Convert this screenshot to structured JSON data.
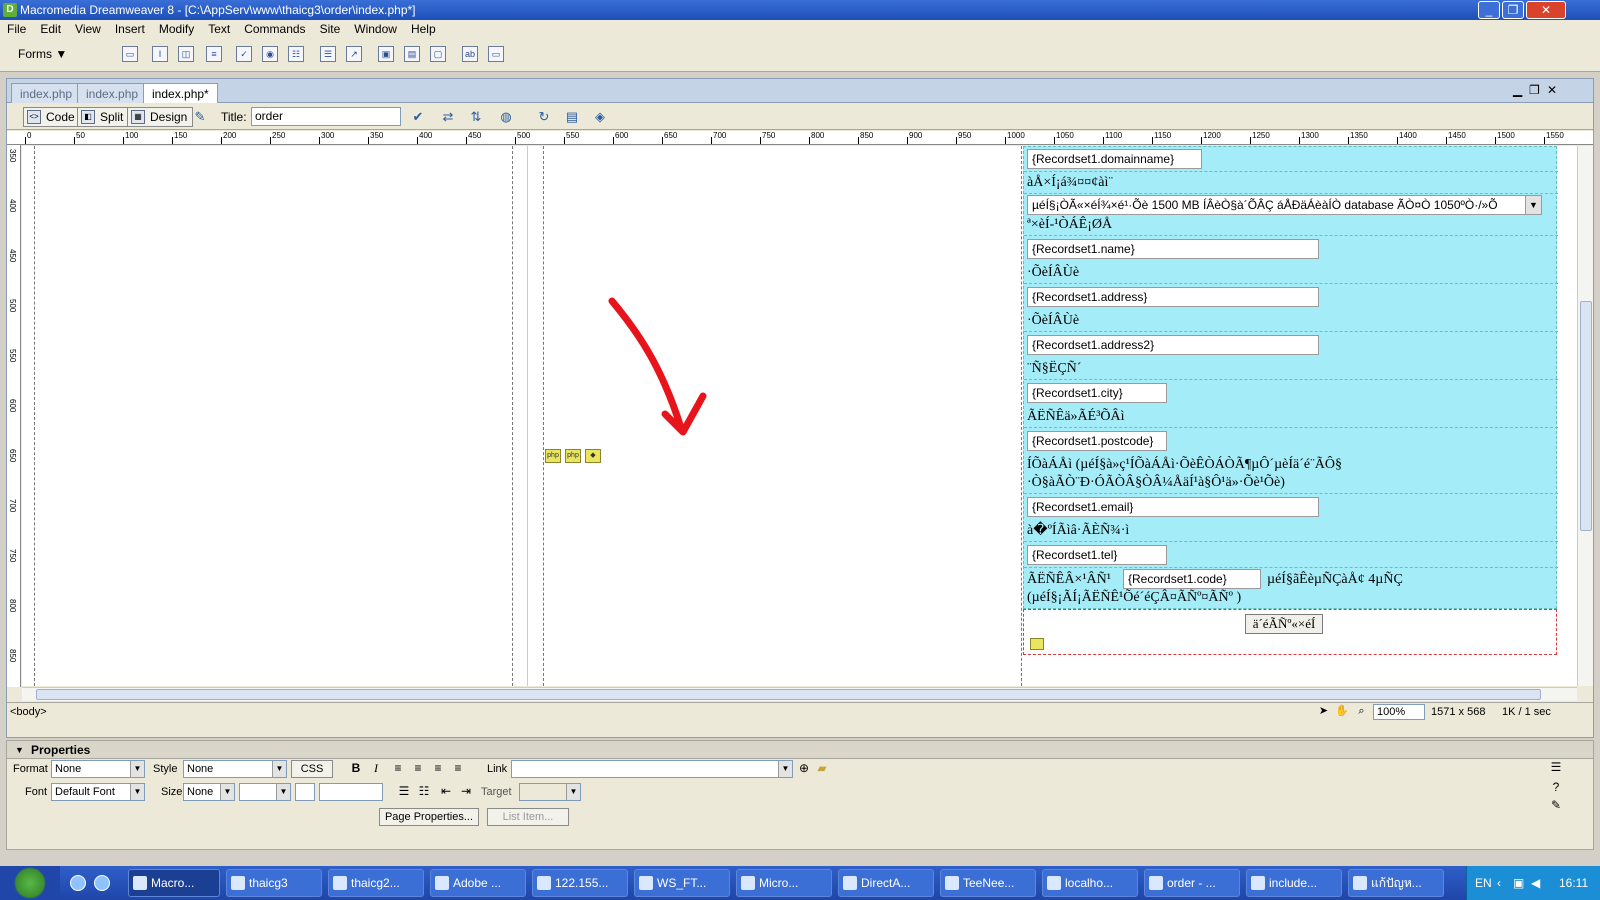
{
  "window": {
    "title": "Macromedia Dreamweaver 8 - [C:\\AppServ\\www\\thaicg3\\order\\index.php*]",
    "controls": [
      "_",
      "❐",
      "✕"
    ]
  },
  "menu": [
    "File",
    "Edit",
    "View",
    "Insert",
    "Modify",
    "Text",
    "Commands",
    "Site",
    "Window",
    "Help"
  ],
  "insert_toolbar": {
    "category": "Forms",
    "icons": [
      "form-icon",
      "text-field-icon",
      "hidden-field-icon",
      "textarea-icon",
      "checkbox-icon",
      "radio-button-icon",
      "radio-group-icon",
      "list-menu-icon",
      "jump-menu-icon",
      "image-field-icon",
      "file-field-icon",
      "button-icon",
      "label-icon",
      "fieldset-icon"
    ]
  },
  "doc_tabs": [
    {
      "label": "index.php",
      "active": false
    },
    {
      "label": "index.php",
      "active": false
    },
    {
      "label": "index.php*",
      "active": true
    }
  ],
  "doc_toolbar": {
    "code_label": "Code",
    "split_label": "Split",
    "design_label": "Design",
    "title_label": "Title:",
    "title_value": "order"
  },
  "ruler": {
    "h_labels": [
      "0",
      "50",
      "100",
      "150",
      "200",
      "250",
      "300",
      "350",
      "400",
      "450",
      "500",
      "550",
      "600",
      "650",
      "700",
      "750",
      "800",
      "850",
      "900",
      "950",
      "1000",
      "1050",
      "1100",
      "1150",
      "1200",
      "1250",
      "1300",
      "1350",
      "1400",
      "1450",
      "1500",
      "1550"
    ],
    "v_labels": [
      "350",
      "400",
      "450",
      "500",
      "550",
      "600",
      "650",
      "700",
      "750",
      "800",
      "850"
    ]
  },
  "form": {
    "rows": [
      {
        "type": "input",
        "text": "{Recordset1.domainname}"
      },
      {
        "type": "label",
        "text": "àÅ×Í¡á¾¤¤¢àì¨"
      },
      {
        "type": "select",
        "text": "µéÍ§¡ÒÃ«×éÍ¾×é¹·Õè 1500 MB ÍÂèÒ§à´ÕÂÇ áÅÐäÁèàÍÒ database ÃÒ¤Ò 1050ºÒ·/»Õ"
      },
      {
        "type": "label",
        "text": "ª×èÍ-¹ÒÁÊ¡ØÅ"
      },
      {
        "type": "input",
        "text": "{Recordset1.name}"
      },
      {
        "type": "label",
        "text": "·ÕèÍÂÙè"
      },
      {
        "type": "input",
        "text": "{Recordset1.address}"
      },
      {
        "type": "label",
        "text": "·ÕèÍÂÙè"
      },
      {
        "type": "input",
        "text": "{Recordset1.address2}"
      },
      {
        "type": "label",
        "text": "¨Ñ§ËÇÑ´"
      },
      {
        "type": "input",
        "text": "{Recordset1.city}"
      },
      {
        "type": "label",
        "text": "ÃËÑÊä»ÃÉ³ÕÂì"
      },
      {
        "type": "input",
        "text": "{Recordset1.postcode}"
      },
      {
        "type": "label",
        "text": "ÍÕàÁÅì (µéÍ§à»ç¹ÍÕàÁÅì·ÕèÊÒÁÒÃ¶µÔ´µèÍä´é¨ÃÔ§"
      },
      {
        "type": "label",
        "text": "·Ò§àÃÒ¨Ð·ÓÃÒÂ§ÒÂ¼ÅäÍ¹à§Ô¹ä»·Õè¹Õè)"
      },
      {
        "type": "input",
        "text": "{Recordset1.email}"
      },
      {
        "type": "label",
        "text": "à�ºÍÃìâ·ÃÈÑ¾·ì"
      },
      {
        "type": "input",
        "text": "{Recordset1.tel}"
      },
      {
        "type": "label",
        "text": "ÃËÑÊÂ×¹ÂÑ¹"
      },
      {
        "type": "input",
        "text": "{Recordset1.code}"
      },
      {
        "type": "label",
        "text": "µéÍ§ãÊèµÑÇàÅ¢ 4µÑÇ"
      },
      {
        "type": "label",
        "text": "(µéÍ§¡ÃÍ¡ÃËÑÊ¹Õé´éÇÂ¤ÃÑº¤ÃÑº )"
      }
    ],
    "submit_label": "ä´éÃÑº«×éÍ"
  },
  "status": {
    "tag": "<body>",
    "zoom": "100%",
    "window_size": "1571 x 568",
    "download": "1K / 1 sec"
  },
  "properties": {
    "header": "Properties",
    "format_label": "Format",
    "format_value": "None",
    "style_label": "Style",
    "style_value": "None",
    "css_label": "CSS",
    "link_label": "Link",
    "link_value": "",
    "font_label": "Font",
    "font_value": "Default Font",
    "size_label": "Size",
    "size_value": "None",
    "target_label": "Target",
    "page_properties_label": "Page Properties...",
    "list_item_label": "List Item..."
  },
  "taskbar": {
    "tasks": [
      "Macro...",
      "thaicg3",
      "thaicg2...",
      "Adobe ...",
      "122.155...",
      "WS_FT...",
      "Micro...",
      "DirectA...",
      "TeeNee...",
      "localho...",
      "order - ...",
      "include...",
      "แก้ปัญห..."
    ],
    "tray_lang": "EN",
    "clock": "16:11"
  },
  "colors": {
    "form_bg": "#a4ecf8",
    "title_bar": "#1d4fb5",
    "arrow": "#e8141b"
  }
}
